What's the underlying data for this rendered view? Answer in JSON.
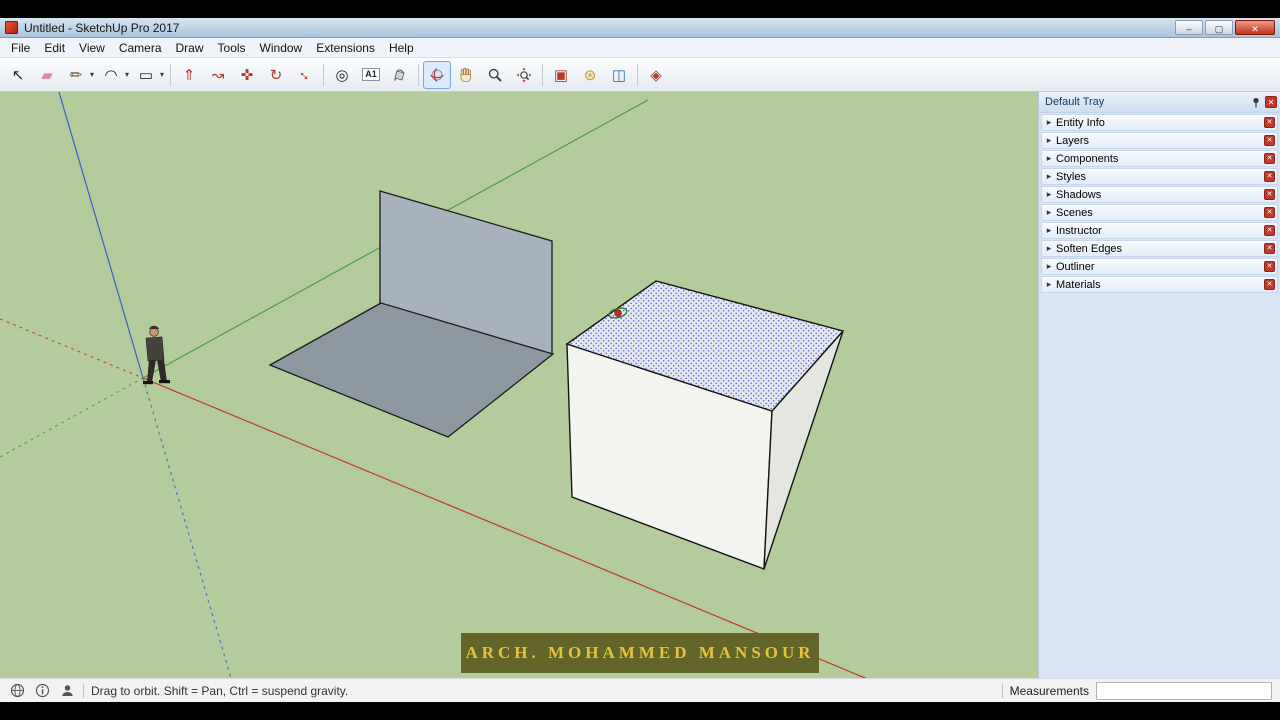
{
  "window": {
    "title": "Untitled - SketchUp Pro 2017",
    "controls": {
      "minimize": "–",
      "maximize": "▢",
      "close": "✕"
    }
  },
  "menu": {
    "items": [
      "File",
      "Edit",
      "View",
      "Camera",
      "Draw",
      "Tools",
      "Window",
      "Extensions",
      "Help"
    ]
  },
  "toolbar": {
    "dropdown_glyph": "▾",
    "tools": [
      {
        "name": "select-tool",
        "glyph": "↖"
      },
      {
        "name": "eraser-tool",
        "glyph": "▰"
      },
      {
        "name": "line-tool",
        "glyph": "✏"
      },
      {
        "name": "arc-tool",
        "glyph": "◠"
      },
      {
        "name": "rectangle-tool",
        "glyph": "▭"
      },
      {
        "name": "push-pull-tool",
        "glyph": "⇑"
      },
      {
        "name": "follow-me-tool",
        "glyph": "↝"
      },
      {
        "name": "move-tool",
        "glyph": "✜"
      },
      {
        "name": "rotate-tool",
        "glyph": "↻"
      },
      {
        "name": "scale-tool",
        "glyph": "↔"
      },
      {
        "name": "tape-measure-tool",
        "glyph": "◎"
      },
      {
        "name": "text-tool",
        "glyph": "A1"
      },
      {
        "name": "paint-bucket-tool"
      },
      {
        "name": "orbit-tool",
        "active": true
      },
      {
        "name": "pan-tool"
      },
      {
        "name": "zoom-tool"
      },
      {
        "name": "zoom-extents-tool"
      },
      {
        "name": "components-tool",
        "glyph": "▣"
      },
      {
        "name": "styles-tool",
        "glyph": "⊛"
      },
      {
        "name": "shadows-tool",
        "glyph": "◫"
      },
      {
        "name": "materials-tool",
        "glyph": "◈"
      }
    ]
  },
  "viewport": {
    "background": "#b4cb9c",
    "axis_colors": {
      "red": "#c0392b",
      "green": "#4a9e3f",
      "blue": "#3a5fcd"
    },
    "watermark": "ARCH. MOHAMMED MANSOUR"
  },
  "tray": {
    "title": "Default Tray",
    "arrow_glyph": "▸",
    "close_glyph": "✕",
    "panels": [
      {
        "label": "Entity Info"
      },
      {
        "label": "Layers"
      },
      {
        "label": "Components"
      },
      {
        "label": "Styles"
      },
      {
        "label": "Shadows"
      },
      {
        "label": "Scenes"
      },
      {
        "label": "Instructor"
      },
      {
        "label": "Soften Edges"
      },
      {
        "label": "Outliner"
      },
      {
        "label": "Materials"
      }
    ]
  },
  "status_bar": {
    "hint": "Drag to orbit. Shift = Pan, Ctrl = suspend gravity.",
    "measurements_label": "Measurements",
    "measurements_value": ""
  }
}
